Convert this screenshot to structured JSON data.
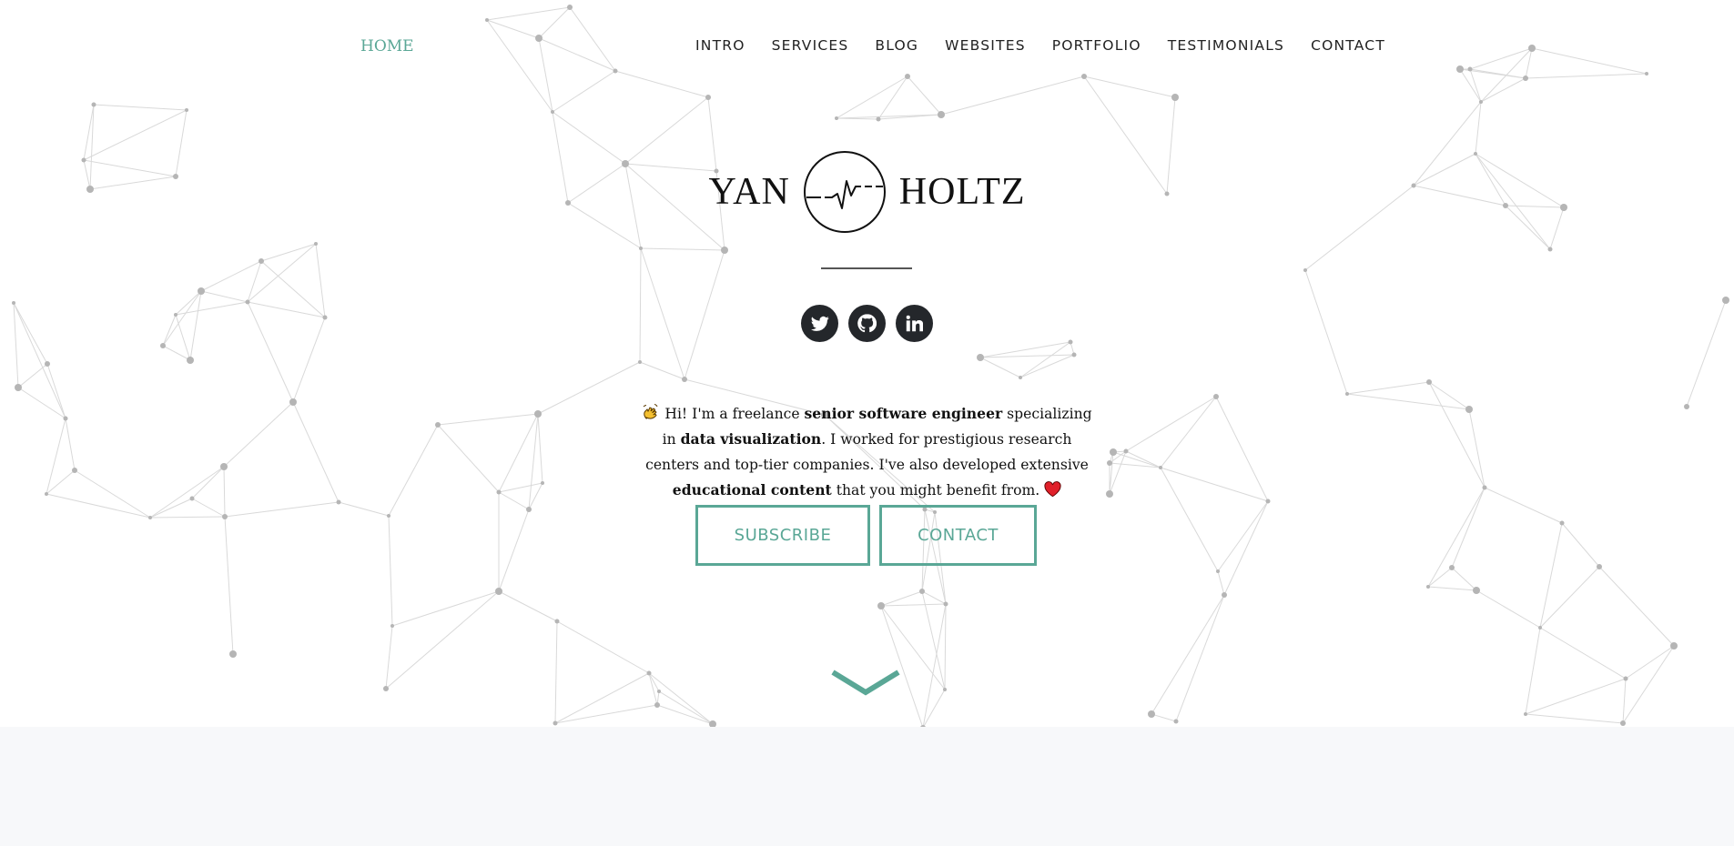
{
  "nav": {
    "home": "HOME",
    "items": [
      "INTRO",
      "SERVICES",
      "BLOG",
      "WEBSITES",
      "PORTFOLIO",
      "TESTIMONIALS",
      "CONTACT"
    ]
  },
  "logo": {
    "first": "YAN",
    "last": "HOLTZ",
    "mark_icon": "heartbeat-circle-icon"
  },
  "socials": [
    {
      "name": "twitter",
      "icon": "twitter-icon"
    },
    {
      "name": "github",
      "icon": "github-icon"
    },
    {
      "name": "linkedin",
      "icon": "linkedin-icon"
    }
  ],
  "bio": {
    "wave_icon": "waving-hand-icon",
    "p1": " Hi! I'm a freelance ",
    "b1": "senior software engineer",
    "p2": " specializing in ",
    "b2": "data visualization",
    "p3": ". I worked for prestigious research centers and top-tier companies. I've also developed extensive ",
    "b3": "educational content",
    "p4": " that you might benefit from. ",
    "heart_icon": "red-heart-icon"
  },
  "buttons": {
    "subscribe": "SUBSCRIBE",
    "contact": "CONTACT"
  },
  "scroll_icon": "chevron-down-icon",
  "colors": {
    "accent": "#5aa796",
    "social_bg": "#24272b",
    "network_node": "#b5b5b5",
    "network_line": "#d9d9d9",
    "band": "#f7f8fa"
  }
}
